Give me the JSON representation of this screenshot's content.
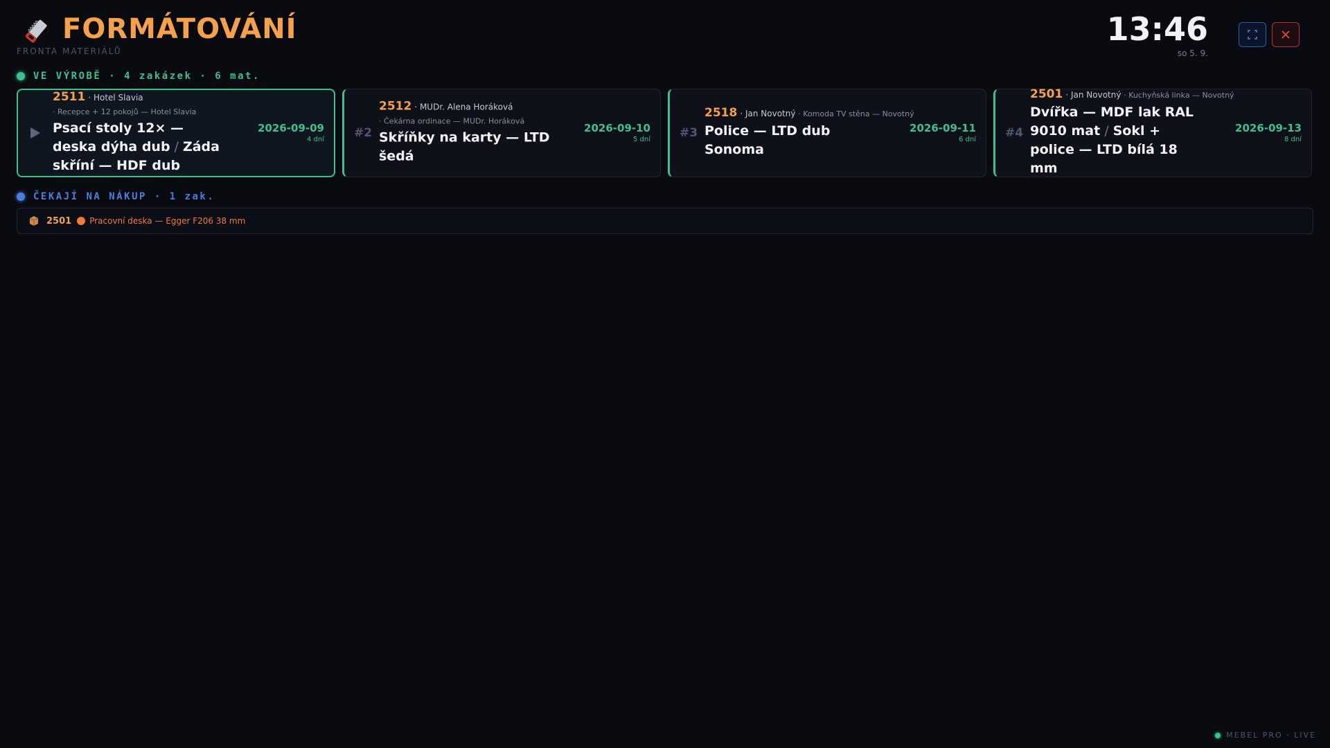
{
  "header": {
    "title": "FORMÁTOVÁNÍ",
    "subtitle": "FRONTA MATERIÁLŮ",
    "clock": "13:46",
    "date": "so 5. 9."
  },
  "sections": {
    "in_production": {
      "label": "VE VÝROBĚ · 4 zakázek · 6 mat."
    },
    "awaiting": {
      "label": "ČEKAJÍ NA NÁKUP · 1 zak."
    }
  },
  "cards": [
    {
      "index": "",
      "number": "2511",
      "client": "· Hotel Slavia",
      "project": "· Recepce + 12 pokojů — Hotel Slavia",
      "materials": [
        "Psací stoly 12× — deska dýha dub",
        "Záda skříní — HDF dub"
      ],
      "date": "2026-09-09",
      "days": "4 dní"
    },
    {
      "index": "#2",
      "number": "2512",
      "client": "· MUDr. Alena Horáková",
      "project": "· Čekárna ordinace — MUDr. Horáková",
      "materials": [
        "Skříňky na karty — LTD šedá"
      ],
      "date": "2026-09-10",
      "days": "5 dní"
    },
    {
      "index": "#3",
      "number": "2518",
      "client": "· Jan Novotný",
      "project": "· Komoda TV stěna — Novotný",
      "materials": [
        "Police — LTD dub Sonoma"
      ],
      "date": "2026-09-11",
      "days": "6 dní"
    },
    {
      "index": "#4",
      "number": "2501",
      "client": "· Jan Novotný",
      "project": "· Kuchyňská linka — Novotný",
      "materials": [
        "Dvířka — MDF lak RAL 9010 mat",
        "Sokl + police — LTD bílá 18 mm"
      ],
      "date": "2026-09-13",
      "days": "8 dní"
    }
  ],
  "pending": {
    "number": "2501",
    "text": "Pracovní deska — Egger F206 38 mm"
  },
  "footer": {
    "label": "MEBEL PRO · LIVE"
  },
  "colors": {
    "accent_orange": "#f5a04a",
    "accent_green": "#3ec08e",
    "accent_blue": "#4a7ee0",
    "danger_red": "#b8323a"
  }
}
